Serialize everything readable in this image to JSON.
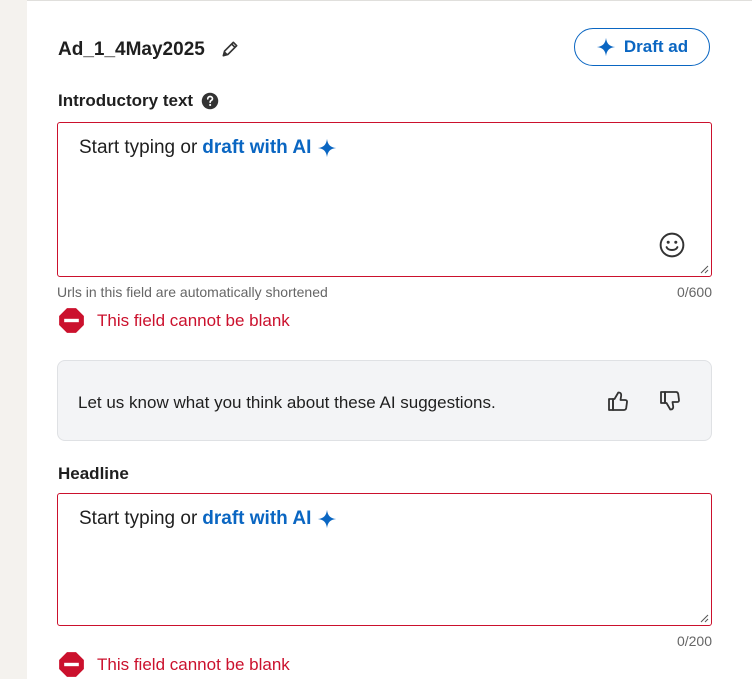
{
  "ad": {
    "name": "Ad_1_4May2025"
  },
  "header": {
    "draft_button_label": "Draft ad"
  },
  "intro": {
    "label": "Introductory text",
    "placeholder_prefix": "Start typing or",
    "placeholder_link": "draft with AI",
    "hint": "Urls in this field are automatically shortened",
    "counter": "0/600",
    "error": "This field cannot be blank"
  },
  "feedback": {
    "text": "Let us know what you think about these AI suggestions."
  },
  "headline": {
    "label": "Headline",
    "placeholder_prefix": "Start typing or",
    "placeholder_link": "draft with AI",
    "counter": "0/200",
    "error": "This field cannot be blank"
  },
  "icons": {
    "edit": "pencil-icon",
    "sparkle": "sparkle-icon",
    "help": "help-circle-icon",
    "emoji": "smiley-icon",
    "error": "error-stop-icon",
    "thumbs_up": "thumbs-up-icon",
    "thumbs_down": "thumbs-down-icon"
  },
  "colors": {
    "accent": "#0a66c2",
    "error": "#cb112d",
    "text": "#1f1f1f",
    "muted": "#666666",
    "page_bg": "#f4f2ee"
  }
}
